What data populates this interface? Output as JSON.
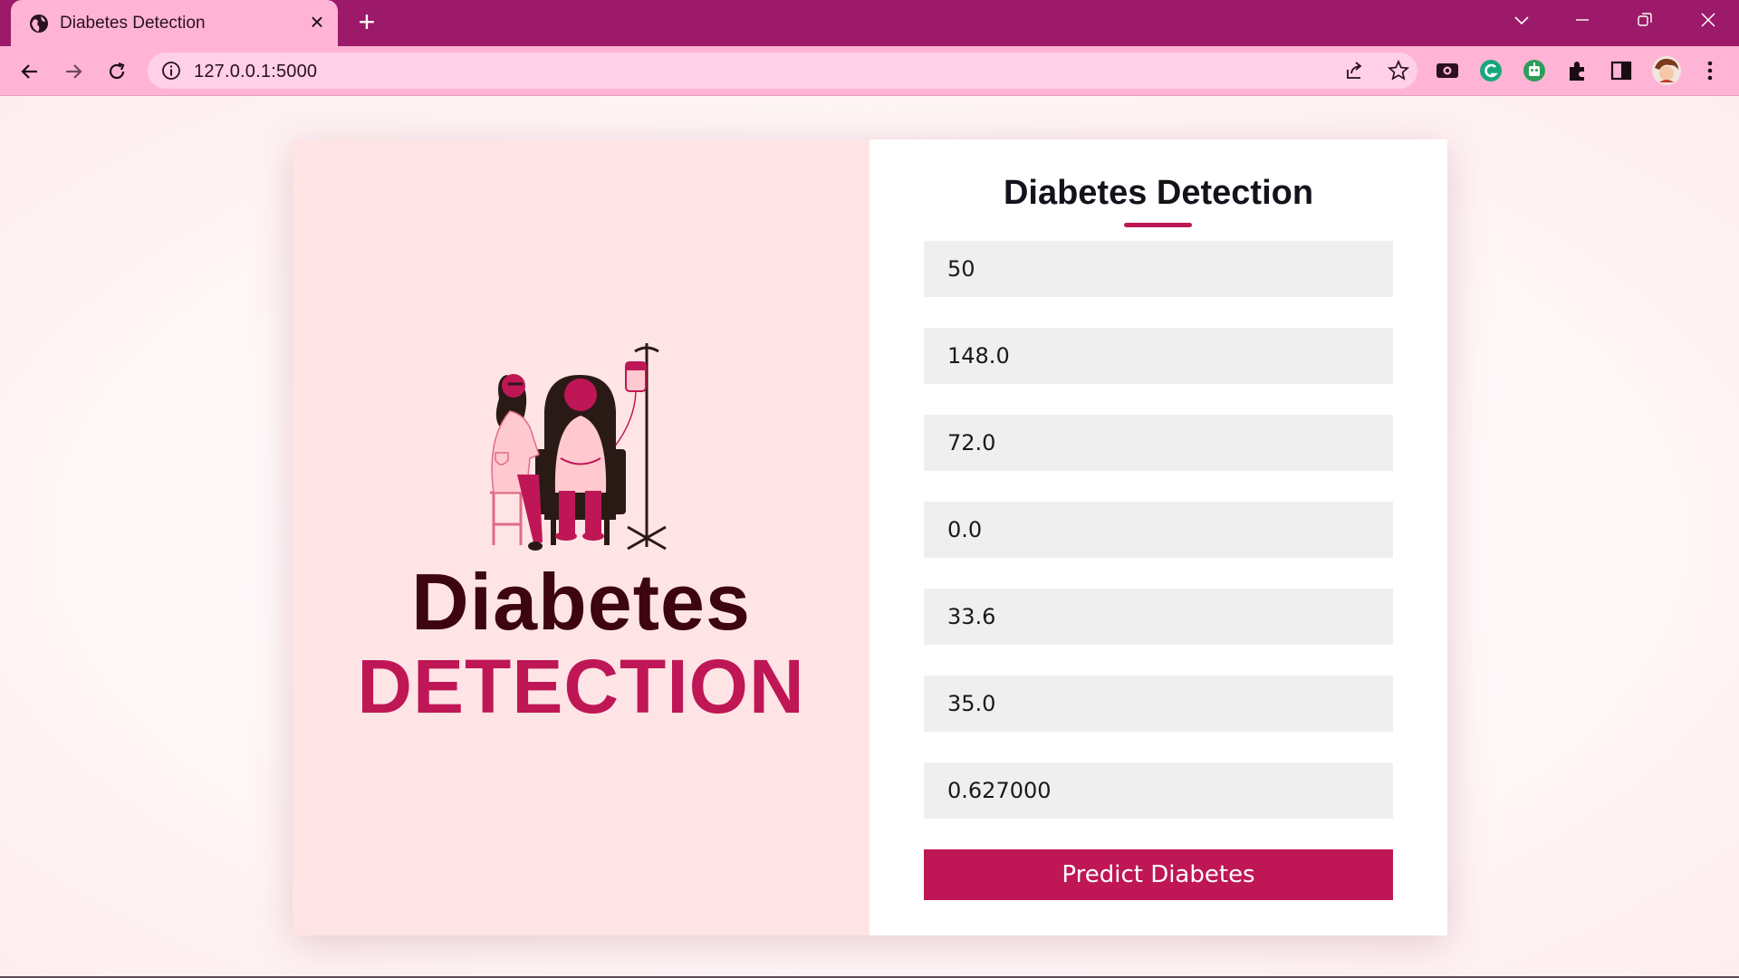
{
  "browser": {
    "tab_title": "Diabetes Detection",
    "url": "127.0.0.1:5000",
    "new_tab_symbol": "+",
    "close_symbol": "×"
  },
  "page": {
    "hero_line1": "Diabetes",
    "hero_line2": "DETECTION",
    "form_title": "Diabetes Detection",
    "fields": [
      "50",
      "148.0",
      "72.0",
      "0.0",
      "33.6",
      "35.0",
      "0.627000"
    ],
    "submit_label": "Predict Diabetes"
  },
  "colors": {
    "tabstrip": "#9c1a69",
    "toolbar": "#ffb4d6",
    "accent": "#bf1656",
    "hero_dark": "#3d0512",
    "left_panel": "#ffe4e5",
    "field_bg": "#efefef"
  },
  "icons": {
    "favicon": "globe-icon",
    "info": "info-icon",
    "share": "share-icon",
    "bookmark": "star-icon",
    "extensions": "puzzle-icon"
  }
}
